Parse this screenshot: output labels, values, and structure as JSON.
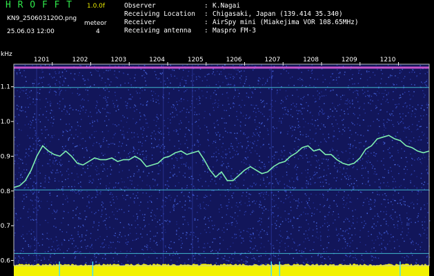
{
  "header": {
    "brand": "H R O F F T",
    "version": "1.0.0f",
    "filename": "KN9_250603120O.png",
    "meteor_label": "meteor",
    "meteor_count": "4",
    "datetime": "25.06.03 12:00",
    "info": [
      {
        "label": "Observer",
        "value": "K.Nagai"
      },
      {
        "label": "Receiving Location",
        "value": "Chigasaki, Japan (139.414 35.340)"
      },
      {
        "label": "Receiver",
        "value": "AirSpy mini (Miakejima VOR 108.65MHz)"
      },
      {
        "label": "Receiving antenna",
        "value": "Maspro FM-3"
      }
    ]
  },
  "colors": {
    "background": "#12165a",
    "trace": "#7ff0b0",
    "reference_line": "#49d6e0",
    "band_top": "#d85ad8",
    "power_bar": "#f2f200",
    "axis_text": "#ffffff"
  },
  "chart_data": {
    "type": "line",
    "title": "",
    "xlabel": "",
    "ylabel": "kHz",
    "x_ticks": [
      "1201",
      "1202",
      "1203",
      "1204",
      "1205",
      "1206",
      "1207",
      "1208",
      "1209",
      "1210"
    ],
    "y_ticks": [
      0.6,
      0.7,
      0.8,
      0.9,
      1.0,
      1.1
    ],
    "xlim": [
      12.0,
      12.18
    ],
    "ylim": [
      0.585,
      1.165
    ],
    "reference_lines_khz": [
      1.155,
      1.098,
      0.803,
      0.62
    ],
    "series": [
      {
        "x": [
          12.0,
          12.0025,
          12.005,
          12.0075,
          12.01,
          12.0125,
          12.015,
          12.0175,
          12.02,
          12.0225,
          12.025,
          12.0275,
          12.03,
          12.0325,
          12.035,
          12.0375,
          12.04,
          12.0425,
          12.045,
          12.0475,
          12.05,
          12.0525,
          12.055,
          12.0575,
          12.06,
          12.0625,
          12.065,
          12.0675,
          12.07,
          12.0725,
          12.075,
          12.0775,
          12.08,
          12.0825,
          12.085,
          12.0875,
          12.09,
          12.0925,
          12.095,
          12.0975,
          12.1,
          12.1025,
          12.105,
          12.1075,
          12.11,
          12.1125,
          12.115,
          12.1175,
          12.12,
          12.1225,
          12.125,
          12.1275,
          12.13,
          12.1325,
          12.135,
          12.1375,
          12.14,
          12.1425,
          12.145,
          12.1475,
          12.15,
          12.1525,
          12.155,
          12.1575,
          12.16,
          12.1625,
          12.165,
          12.1675,
          12.17,
          12.1725,
          12.175,
          12.1775,
          12.18
        ],
        "values": [
          0.81,
          0.815,
          0.83,
          0.86,
          0.9,
          0.93,
          0.915,
          0.905,
          0.9,
          0.915,
          0.9,
          0.88,
          0.875,
          0.885,
          0.895,
          0.89,
          0.89,
          0.895,
          0.885,
          0.89,
          0.89,
          0.9,
          0.89,
          0.87,
          0.875,
          0.88,
          0.895,
          0.9,
          0.91,
          0.915,
          0.905,
          0.91,
          0.915,
          0.89,
          0.86,
          0.84,
          0.855,
          0.83,
          0.83,
          0.845,
          0.86,
          0.87,
          0.86,
          0.85,
          0.855,
          0.87,
          0.88,
          0.885,
          0.9,
          0.91,
          0.925,
          0.93,
          0.915,
          0.92,
          0.905,
          0.905,
          0.89,
          0.88,
          0.875,
          0.88,
          0.895,
          0.92,
          0.93,
          0.95,
          0.955,
          0.96,
          0.95,
          0.945,
          0.93,
          0.925,
          0.915,
          0.91,
          0.915
        ]
      }
    ],
    "grid": false,
    "legend": "none"
  }
}
